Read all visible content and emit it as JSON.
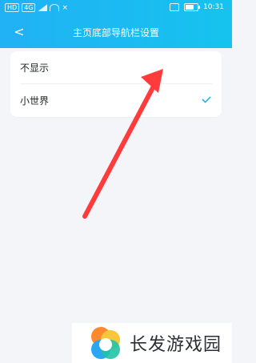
{
  "status": {
    "left_badges": [
      "HD",
      "4G"
    ],
    "left_extra": "×",
    "time": "10:31",
    "battery_percent": 60
  },
  "header": {
    "title": "主页底部导航栏设置",
    "back_icon": "chevron-left"
  },
  "settings": {
    "options": [
      {
        "label": "不显示",
        "selected": false
      },
      {
        "label": "小世界",
        "selected": true
      }
    ],
    "check_color": "#13b0e6"
  },
  "overlay": {
    "arrow_color": "#ff3b3b"
  },
  "watermark": {
    "text": "长发游戏园"
  },
  "colors": {
    "header_start": "#21b1f5",
    "header_end": "#16c3ee",
    "background": "#f3f5f9"
  }
}
